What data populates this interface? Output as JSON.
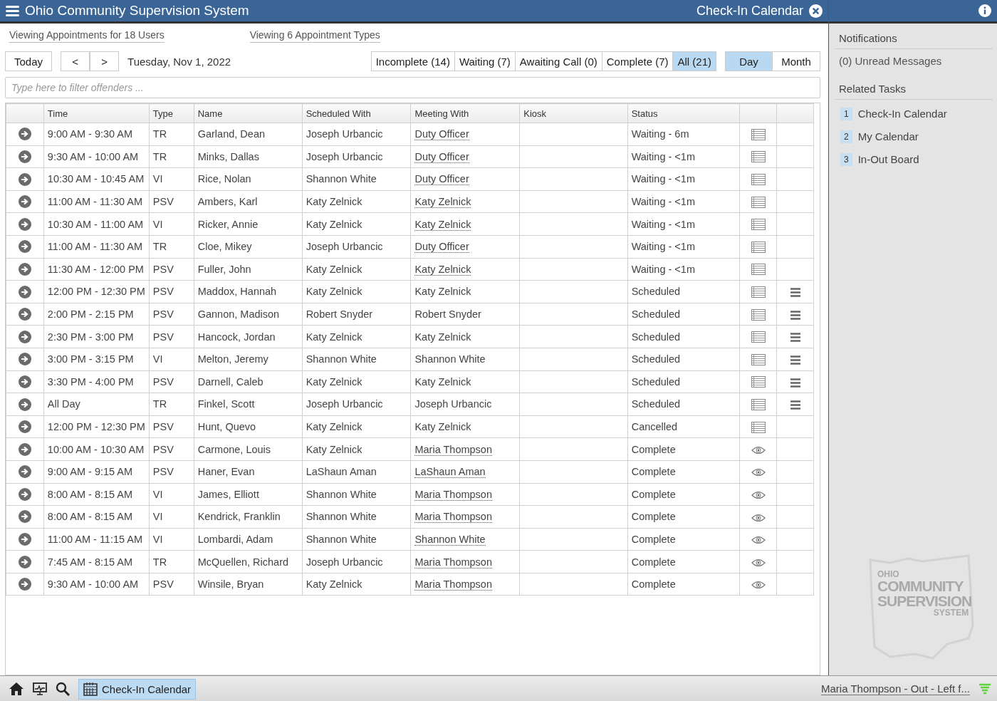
{
  "window": {
    "title": "Ohio Community Supervision System",
    "page_title": "Check-In Calendar"
  },
  "filters": {
    "users": "Viewing Appointments for 18 Users",
    "types": "Viewing 6 Appointment Types"
  },
  "nav": {
    "today": "Today",
    "prev": "<",
    "next": ">",
    "date": "Tuesday, Nov 1, 2022"
  },
  "status_tabs": [
    {
      "label": "Incomplete (14)",
      "selected": false
    },
    {
      "label": "Waiting (7)",
      "selected": false
    },
    {
      "label": "Awaiting Call (0)",
      "selected": false
    },
    {
      "label": "Complete (7)",
      "selected": false
    },
    {
      "label": "All (21)",
      "selected": true
    }
  ],
  "view_tabs": [
    {
      "label": "Day",
      "selected": true
    },
    {
      "label": "Month",
      "selected": false
    }
  ],
  "search": {
    "placeholder": "Type here to filter offenders ..."
  },
  "table": {
    "columns": [
      "Time",
      "Type",
      "Name",
      "Scheduled With",
      "Meeting With",
      "Kiosk",
      "Status"
    ],
    "rows": [
      {
        "time": "9:00 AM - 9:30 AM",
        "type": "TR",
        "name": "Garland, Dean",
        "scheduled_with": "Joseph Urbancic",
        "meeting_with": "Duty Officer",
        "meeting_linked": true,
        "status": "Waiting - 6m",
        "kind": "notes",
        "menu": false
      },
      {
        "time": "9:30 AM - 10:00 AM",
        "type": "TR",
        "name": "Minks, Dallas",
        "scheduled_with": "Joseph Urbancic",
        "meeting_with": "Duty Officer",
        "meeting_linked": true,
        "status": "Waiting - <1m",
        "kind": "notes",
        "menu": false
      },
      {
        "time": "10:30 AM - 10:45 AM",
        "type": "VI",
        "name": "Rice, Nolan",
        "scheduled_with": "Shannon White",
        "meeting_with": "Duty Officer",
        "meeting_linked": true,
        "status": "Waiting - <1m",
        "kind": "notes",
        "menu": false
      },
      {
        "time": "11:00 AM - 11:30 AM",
        "type": "PSV",
        "name": "Ambers, Karl",
        "scheduled_with": "Katy Zelnick",
        "meeting_with": "Katy Zelnick",
        "meeting_linked": true,
        "status": "Waiting - <1m",
        "kind": "notes",
        "menu": false
      },
      {
        "time": "10:30 AM - 11:00 AM",
        "type": "VI",
        "name": "Ricker, Annie",
        "scheduled_with": "Katy Zelnick",
        "meeting_with": "Katy Zelnick",
        "meeting_linked": true,
        "status": "Waiting - <1m",
        "kind": "notes",
        "menu": false
      },
      {
        "time": "11:00 AM - 11:30 AM",
        "type": "TR",
        "name": "Cloe, Mikey",
        "scheduled_with": "Joseph Urbancic",
        "meeting_with": "Duty Officer",
        "meeting_linked": true,
        "status": "Waiting - <1m",
        "kind": "notes",
        "menu": false
      },
      {
        "time": "11:30 AM - 12:00 PM",
        "type": "PSV",
        "name": "Fuller, John",
        "scheduled_with": "Katy Zelnick",
        "meeting_with": "Katy Zelnick",
        "meeting_linked": true,
        "status": "Waiting - <1m",
        "kind": "notes",
        "menu": false
      },
      {
        "time": "12:00 PM - 12:30 PM",
        "type": "PSV",
        "name": "Maddox, Hannah",
        "scheduled_with": "Katy Zelnick",
        "meeting_with": "Katy Zelnick",
        "meeting_linked": false,
        "status": "Scheduled",
        "kind": "notes",
        "menu": true
      },
      {
        "time": "2:00 PM - 2:15 PM",
        "type": "PSV",
        "name": "Gannon, Madison",
        "scheduled_with": "Robert Snyder",
        "meeting_with": "Robert Snyder",
        "meeting_linked": false,
        "status": "Scheduled",
        "kind": "notes",
        "menu": true
      },
      {
        "time": "2:30 PM - 3:00 PM",
        "type": "PSV",
        "name": "Hancock, Jordan",
        "scheduled_with": "Katy Zelnick",
        "meeting_with": "Katy Zelnick",
        "meeting_linked": false,
        "status": "Scheduled",
        "kind": "notes",
        "menu": true
      },
      {
        "time": "3:00 PM - 3:15 PM",
        "type": "VI",
        "name": "Melton, Jeremy",
        "scheduled_with": "Shannon White",
        "meeting_with": "Shannon White",
        "meeting_linked": false,
        "status": "Scheduled",
        "kind": "notes",
        "menu": true
      },
      {
        "time": "3:30 PM - 4:00 PM",
        "type": "PSV",
        "name": "Darnell, Caleb",
        "scheduled_with": "Katy Zelnick",
        "meeting_with": "Katy Zelnick",
        "meeting_linked": false,
        "status": "Scheduled",
        "kind": "notes",
        "menu": true
      },
      {
        "time": "All Day",
        "type": "TR",
        "name": "Finkel, Scott",
        "scheduled_with": "Joseph Urbancic",
        "meeting_with": "Joseph Urbancic",
        "meeting_linked": false,
        "status": "Scheduled",
        "kind": "notes",
        "menu": true
      },
      {
        "time": "12:00 PM - 12:30 PM",
        "type": "PSV",
        "name": "Hunt, Quevo",
        "scheduled_with": "Katy Zelnick",
        "meeting_with": "Katy Zelnick",
        "meeting_linked": false,
        "status": "Cancelled",
        "kind": "notes",
        "menu": false
      },
      {
        "time": "10:00 AM - 10:30 AM",
        "type": "PSV",
        "name": "Carmone, Louis",
        "scheduled_with": "Katy Zelnick",
        "meeting_with": "Maria Thompson",
        "meeting_linked": true,
        "status": "Complete",
        "kind": "view",
        "menu": false
      },
      {
        "time": "9:00 AM - 9:15 AM",
        "type": "PSV",
        "name": "Haner, Evan",
        "scheduled_with": "LaShaun Aman",
        "meeting_with": "LaShaun Aman",
        "meeting_linked": true,
        "status": "Complete",
        "kind": "view",
        "menu": false
      },
      {
        "time": "8:00 AM - 8:15 AM",
        "type": "VI",
        "name": "James, Elliott",
        "scheduled_with": "Shannon White",
        "meeting_with": "Maria Thompson",
        "meeting_linked": true,
        "status": "Complete",
        "kind": "view",
        "menu": false
      },
      {
        "time": "8:00 AM - 8:15 AM",
        "type": "VI",
        "name": "Kendrick, Franklin",
        "scheduled_with": "Shannon White",
        "meeting_with": "Maria Thompson",
        "meeting_linked": true,
        "status": "Complete",
        "kind": "view",
        "menu": false
      },
      {
        "time": "11:00 AM - 11:15 AM",
        "type": "VI",
        "name": "Lombardi, Adam",
        "scheduled_with": "Shannon White",
        "meeting_with": "Shannon White",
        "meeting_linked": true,
        "status": "Complete",
        "kind": "view",
        "menu": false
      },
      {
        "time": "7:45 AM - 8:15 AM",
        "type": "TR",
        "name": "McQuellen, Richard",
        "scheduled_with": "Joseph Urbancic",
        "meeting_with": "Maria Thompson",
        "meeting_linked": true,
        "status": "Complete",
        "kind": "view",
        "menu": false
      },
      {
        "time": "9:30 AM - 10:00 AM",
        "type": "PSV",
        "name": "Winsile, Bryan",
        "scheduled_with": "Katy Zelnick",
        "meeting_with": "Maria Thompson",
        "meeting_linked": true,
        "status": "Complete",
        "kind": "view",
        "menu": false
      }
    ]
  },
  "sidebar": {
    "notifications_title": "Notifications",
    "unread": "(0) Unread Messages",
    "tasks_title": "Related Tasks",
    "tasks": [
      {
        "number": "1",
        "label": "Check-In Calendar"
      },
      {
        "number": "2",
        "label": "My Calendar"
      },
      {
        "number": "3",
        "label": "In-Out Board"
      }
    ],
    "logo": [
      "OHIO",
      "COMMUNITY",
      "SUPERVISION",
      "SYSTEM"
    ]
  },
  "taskbar": {
    "active_app": "Check-In Calendar",
    "status": "Maria Thompson - Out - Left f..."
  }
}
